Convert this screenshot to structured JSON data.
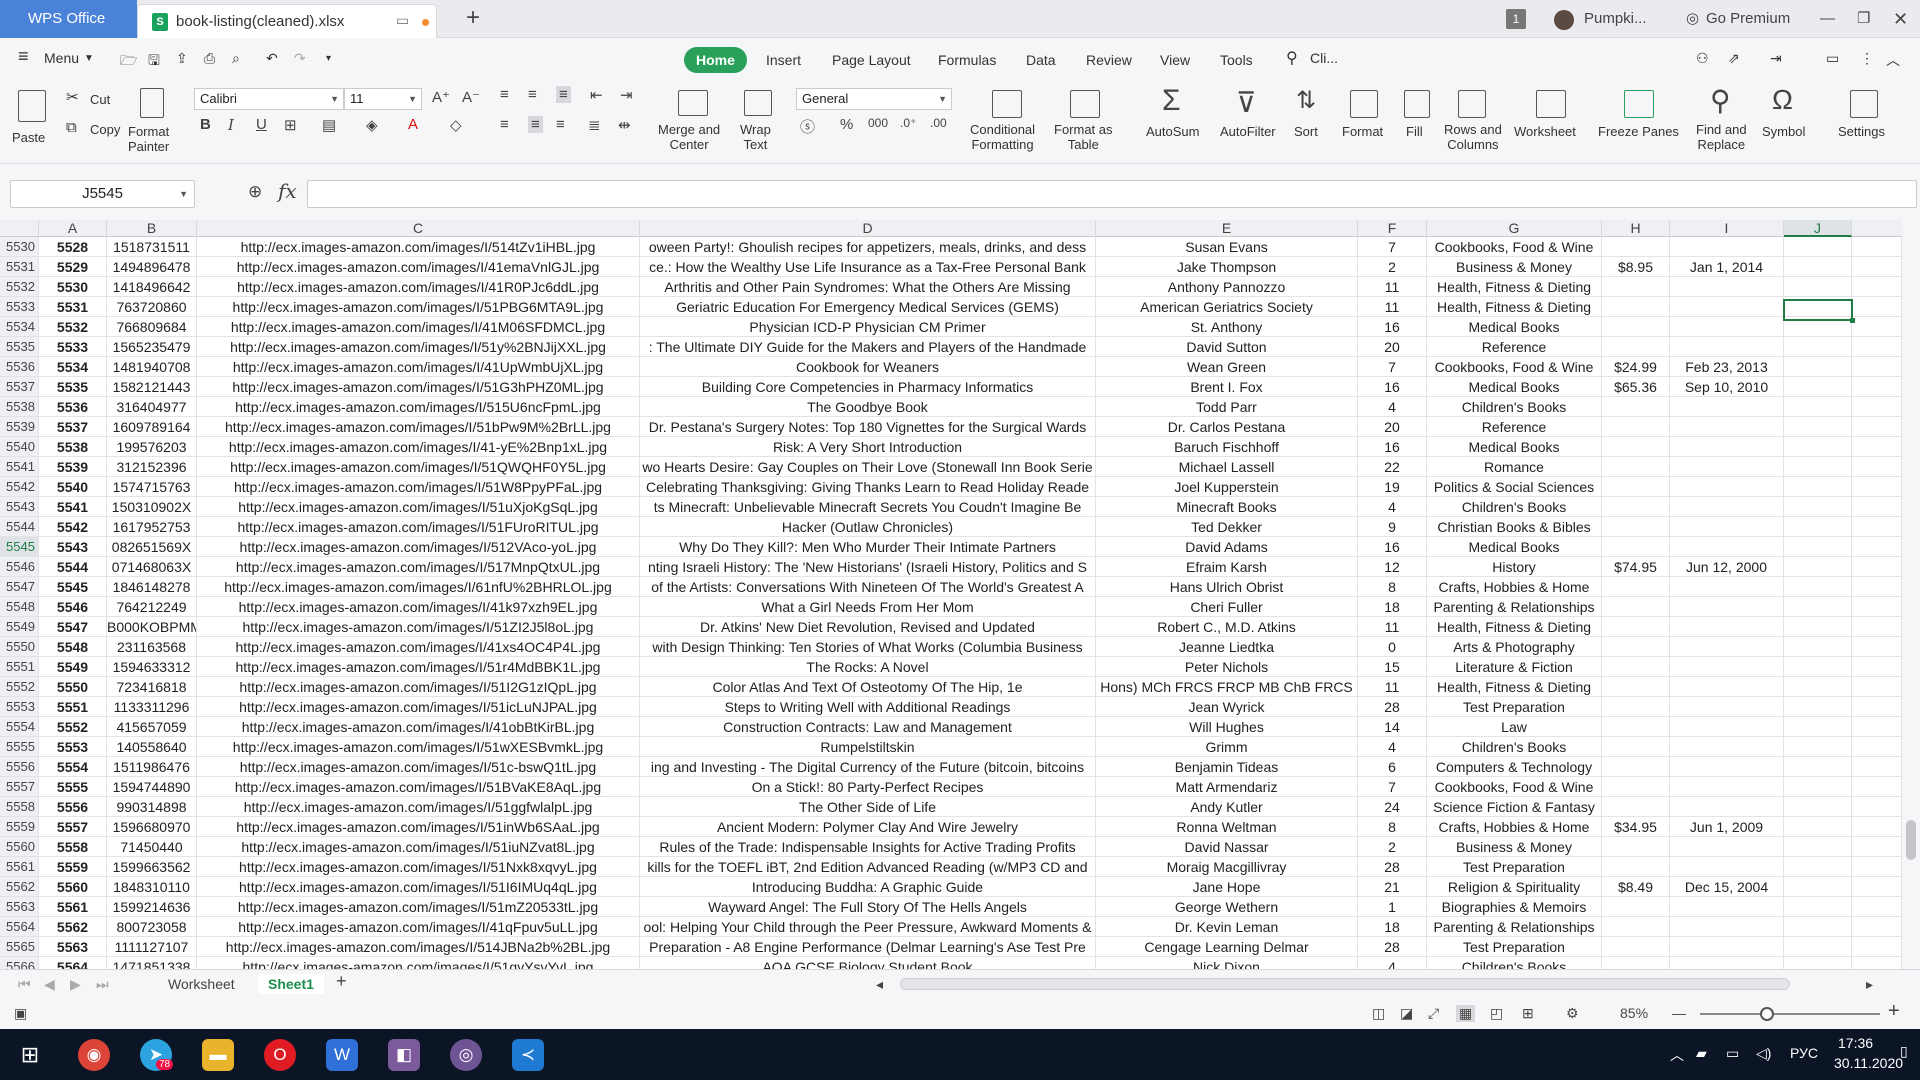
{
  "titlebar": {
    "app_name": "WPS Office",
    "doc_name": "book-listing(cleaned).xlsx",
    "window_count": "1",
    "user_name": "Pumpki...",
    "premium": "Go Premium"
  },
  "menu": {
    "menu_label": "Menu",
    "tabs": [
      "Home",
      "Insert",
      "Page Layout",
      "Formulas",
      "Data",
      "Review",
      "View",
      "Tools"
    ],
    "search": "Cli..."
  },
  "ribbon": {
    "paste": "Paste",
    "cut": "Cut",
    "copy": "Copy",
    "format_painter": "Format\nPainter",
    "font": "Calibri",
    "font_size": "11",
    "merge": "Merge and\nCenter",
    "wrap": "Wrap\nText",
    "number_format": "General",
    "cond_format": "Conditional\nFormatting",
    "format_table": "Format as\nTable",
    "autosum": "AutoSum",
    "autofilter": "AutoFilter",
    "sort": "Sort",
    "format": "Format",
    "fill": "Fill",
    "rows_cols": "Rows and\nColumns",
    "worksheet": "Worksheet",
    "freeze": "Freeze Panes",
    "find_replace": "Find and\nReplace",
    "symbol": "Symbol",
    "settings": "Settings"
  },
  "formula_bar": {
    "name_box": "J5545",
    "fx": "fx",
    "formula": ""
  },
  "columns": [
    "A",
    "B",
    "C",
    "D",
    "E",
    "F",
    "G",
    "H",
    "I",
    "J"
  ],
  "rows": [
    {
      "r": "5530",
      "a": "5528",
      "b": "1518731511",
      "c": "http://ecx.images-amazon.com/images/I/514tZv1iHBL.jpg",
      "d": "oween Party!: Ghoulish recipes for appetizers, meals, drinks, and dess",
      "e": "Susan Evans",
      "f": "7",
      "g": "Cookbooks, Food & Wine",
      "h": "",
      "i": ""
    },
    {
      "r": "5531",
      "a": "5529",
      "b": "1494896478",
      "c": "http://ecx.images-amazon.com/images/I/41emaVnlGJL.jpg",
      "d": "ce.: How the Wealthy Use Life Insurance as a Tax-Free Personal Bank",
      "e": "Jake Thompson",
      "f": "2",
      "g": "Business & Money",
      "h": "$8.95",
      "i": "Jan 1, 2014"
    },
    {
      "r": "5532",
      "a": "5530",
      "b": "1418496642",
      "c": "http://ecx.images-amazon.com/images/I/41R0PJc6ddL.jpg",
      "d": "Arthritis and Other Pain Syndromes: What the Others Are Missing",
      "e": "Anthony Pannozzo",
      "f": "11",
      "g": "Health, Fitness & Dieting",
      "h": "",
      "i": ""
    },
    {
      "r": "5533",
      "a": "5531",
      "b": "763720860",
      "c": "http://ecx.images-amazon.com/images/I/51PBG6MTA9L.jpg",
      "d": "Geriatric Education For Emergency Medical Services (GEMS)",
      "e": "American Geriatrics Society",
      "f": "11",
      "g": "Health, Fitness & Dieting",
      "h": "",
      "i": ""
    },
    {
      "r": "5534",
      "a": "5532",
      "b": "766809684",
      "c": "http://ecx.images-amazon.com/images/I/41M06SFDMCL.jpg",
      "d": "Physician ICD-P Physician CM Primer",
      "e": "St. Anthony",
      "f": "16",
      "g": "Medical Books",
      "h": "",
      "i": ""
    },
    {
      "r": "5535",
      "a": "5533",
      "b": "1565235479",
      "c": "http://ecx.images-amazon.com/images/I/51y%2BNJijXXL.jpg",
      "d": ": The Ultimate DIY Guide for the Makers and Players of the Handmade",
      "e": "David Sutton",
      "f": "20",
      "g": "Reference",
      "h": "",
      "i": ""
    },
    {
      "r": "5536",
      "a": "5534",
      "b": "1481940708",
      "c": "http://ecx.images-amazon.com/images/I/41UpWmbUjXL.jpg",
      "d": "Cookbook for Weaners",
      "e": "Wean Green",
      "f": "7",
      "g": "Cookbooks, Food & Wine",
      "h": "$24.99",
      "i": "Feb 23, 2013"
    },
    {
      "r": "5537",
      "a": "5535",
      "b": "1582121443",
      "c": "http://ecx.images-amazon.com/images/I/51G3hPHZ0ML.jpg",
      "d": "Building Core Competencies in Pharmacy Informatics",
      "e": "Brent I. Fox",
      "f": "16",
      "g": "Medical Books",
      "h": "$65.36",
      "i": "Sep 10, 2010"
    },
    {
      "r": "5538",
      "a": "5536",
      "b": "316404977",
      "c": "http://ecx.images-amazon.com/images/I/515U6ncFpmL.jpg",
      "d": "The Goodbye Book",
      "e": "Todd Parr",
      "f": "4",
      "g": "Children's Books",
      "h": "",
      "i": ""
    },
    {
      "r": "5539",
      "a": "5537",
      "b": "1609789164",
      "c": "http://ecx.images-amazon.com/images/I/51bPw9M%2BrLL.jpg",
      "d": "Dr. Pestana's Surgery Notes: Top 180 Vignettes for the Surgical Wards",
      "e": "Dr. Carlos Pestana",
      "f": "20",
      "g": "Reference",
      "h": "",
      "i": ""
    },
    {
      "r": "5540",
      "a": "5538",
      "b": "199576203",
      "c": "http://ecx.images-amazon.com/images/I/41-yE%2Bnp1xL.jpg",
      "d": "Risk: A Very Short Introduction",
      "e": "Baruch Fischhoff",
      "f": "16",
      "g": "Medical Books",
      "h": "",
      "i": ""
    },
    {
      "r": "5541",
      "a": "5539",
      "b": "312152396",
      "c": "http://ecx.images-amazon.com/images/I/51QWQHF0Y5L.jpg",
      "d": "wo Hearts Desire: Gay Couples on Their Love (Stonewall Inn Book Serie",
      "e": "Michael Lassell",
      "f": "22",
      "g": "Romance",
      "h": "",
      "i": ""
    },
    {
      "r": "5542",
      "a": "5540",
      "b": "1574715763",
      "c": "http://ecx.images-amazon.com/images/I/51W8PpyPFaL.jpg",
      "d": "Celebrating Thanksgiving: Giving Thanks Learn to Read Holiday Reade",
      "e": "Joel Kupperstein",
      "f": "19",
      "g": "Politics & Social Sciences",
      "h": "",
      "i": ""
    },
    {
      "r": "5543",
      "a": "5541",
      "b": "150310902X",
      "c": "http://ecx.images-amazon.com/images/I/51uXjoKgSqL.jpg",
      "d": "ts  Minecraft: Unbelievable Minecraft Secrets You Coudn't Imagine Be",
      "e": "Minecraft Books",
      "f": "4",
      "g": "Children's Books",
      "h": "",
      "i": ""
    },
    {
      "r": "5544",
      "a": "5542",
      "b": "1617952753",
      "c": "http://ecx.images-amazon.com/images/I/51FUroRITUL.jpg",
      "d": "Hacker (Outlaw Chronicles)",
      "e": "Ted Dekker",
      "f": "9",
      "g": "Christian Books & Bibles",
      "h": "",
      "i": ""
    },
    {
      "r": "5545",
      "a": "5543",
      "b": "082651569X",
      "c": "http://ecx.images-amazon.com/images/I/512VAco-yoL.jpg",
      "d": "Why Do They Kill?: Men Who Murder Their Intimate Partners",
      "e": "David Adams",
      "f": "16",
      "g": "Medical Books",
      "h": "",
      "i": ""
    },
    {
      "r": "5546",
      "a": "5544",
      "b": "071468063X",
      "c": "http://ecx.images-amazon.com/images/I/517MnpQtxUL.jpg",
      "d": "nting Israeli History: The 'New Historians' (Israeli History, Politics and S",
      "e": "Efraim Karsh",
      "f": "12",
      "g": "History",
      "h": "$74.95",
      "i": "Jun 12, 2000"
    },
    {
      "r": "5547",
      "a": "5545",
      "b": "1846148278",
      "c": "http://ecx.images-amazon.com/images/I/61nfU%2BHRLOL.jpg",
      "d": "of the Artists: Conversations With Nineteen Of The World's Greatest A",
      "e": "Hans Ulrich Obrist",
      "f": "8",
      "g": "Crafts, Hobbies & Home",
      "h": "",
      "i": ""
    },
    {
      "r": "5548",
      "a": "5546",
      "b": "764212249",
      "c": "http://ecx.images-amazon.com/images/I/41k97xzh9EL.jpg",
      "d": "What a Girl Needs From Her Mom",
      "e": "Cheri Fuller",
      "f": "18",
      "g": "Parenting & Relationships",
      "h": "",
      "i": ""
    },
    {
      "r": "5549",
      "a": "5547",
      "b": "B000KOBPMM",
      "c": "http://ecx.images-amazon.com/images/I/51ZI2J5l8oL.jpg",
      "d": "Dr. Atkins' New Diet Revolution, Revised and Updated",
      "e": "Robert C., M.D. Atkins",
      "f": "11",
      "g": "Health, Fitness & Dieting",
      "h": "",
      "i": ""
    },
    {
      "r": "5550",
      "a": "5548",
      "b": "231163568",
      "c": "http://ecx.images-amazon.com/images/I/41xs4OC4P4L.jpg",
      "d": "with Design Thinking: Ten Stories of What Works (Columbia Business",
      "e": "Jeanne Liedtka",
      "f": "0",
      "g": "Arts & Photography",
      "h": "",
      "i": ""
    },
    {
      "r": "5551",
      "a": "5549",
      "b": "1594633312",
      "c": "http://ecx.images-amazon.com/images/I/51r4MdBBK1L.jpg",
      "d": "The Rocks: A Novel",
      "e": "Peter Nichols",
      "f": "15",
      "g": "Literature & Fiction",
      "h": "",
      "i": ""
    },
    {
      "r": "5552",
      "a": "5550",
      "b": "723416818",
      "c": "http://ecx.images-amazon.com/images/I/51I2G1zIQpL.jpg",
      "d": "Color Atlas And Text Of Osteotomy Of The Hip, 1e",
      "e": "Hons)  MCh  FRCS  FRCP  MB  ChB  FRCS",
      "f": "11",
      "g": "Health, Fitness & Dieting",
      "h": "",
      "i": ""
    },
    {
      "r": "5553",
      "a": "5551",
      "b": "1133311296",
      "c": "http://ecx.images-amazon.com/images/I/51icLuNJPAL.jpg",
      "d": "Steps to Writing Well with Additional Readings",
      "e": "Jean Wyrick",
      "f": "28",
      "g": "Test Preparation",
      "h": "",
      "i": ""
    },
    {
      "r": "5554",
      "a": "5552",
      "b": "415657059",
      "c": "http://ecx.images-amazon.com/images/I/41obBtKirBL.jpg",
      "d": "Construction Contracts: Law and Management",
      "e": "Will Hughes",
      "f": "14",
      "g": "Law",
      "h": "",
      "i": ""
    },
    {
      "r": "5555",
      "a": "5553",
      "b": "140558640",
      "c": "http://ecx.images-amazon.com/images/I/51wXESBvmkL.jpg",
      "d": "Rumpelstiltskin",
      "e": "Grimm",
      "f": "4",
      "g": "Children's Books",
      "h": "",
      "i": ""
    },
    {
      "r": "5556",
      "a": "5554",
      "b": "1511986476",
      "c": "http://ecx.images-amazon.com/images/I/51c-bswQ1tL.jpg",
      "d": "ing and Investing - The Digital Currency of the Future (bitcoin, bitcoins",
      "e": "Benjamin Tideas",
      "f": "6",
      "g": "Computers & Technology",
      "h": "",
      "i": ""
    },
    {
      "r": "5557",
      "a": "5555",
      "b": "1594744890",
      "c": "http://ecx.images-amazon.com/images/I/51BVaKE8AqL.jpg",
      "d": "On a Stick!: 80 Party-Perfect Recipes",
      "e": "Matt Armendariz",
      "f": "7",
      "g": "Cookbooks, Food & Wine",
      "h": "",
      "i": ""
    },
    {
      "r": "5558",
      "a": "5556",
      "b": "990314898",
      "c": "http://ecx.images-amazon.com/images/I/51ggfwlalpL.jpg",
      "d": "The Other Side of Life",
      "e": "Andy Kutler",
      "f": "24",
      "g": "Science Fiction & Fantasy",
      "h": "",
      "i": ""
    },
    {
      "r": "5559",
      "a": "5557",
      "b": "1596680970",
      "c": "http://ecx.images-amazon.com/images/I/51inWb6SAaL.jpg",
      "d": "Ancient Modern: Polymer Clay And Wire Jewelry",
      "e": "Ronna Weltman",
      "f": "8",
      "g": "Crafts, Hobbies & Home",
      "h": "$34.95",
      "i": "Jun 1, 2009"
    },
    {
      "r": "5560",
      "a": "5558",
      "b": "71450440",
      "c": "http://ecx.images-amazon.com/images/I/51iuNZvat8L.jpg",
      "d": "Rules of the Trade: Indispensable Insights for Active Trading Profits",
      "e": "David Nassar",
      "f": "2",
      "g": "Business & Money",
      "h": "",
      "i": ""
    },
    {
      "r": "5561",
      "a": "5559",
      "b": "1599663562",
      "c": "http://ecx.images-amazon.com/images/I/51Nxk8xqvyL.jpg",
      "d": "kills for the TOEFL iBT, 2nd Edition Advanced Reading (w/MP3 CD and",
      "e": "Moraig Macgillivray",
      "f": "28",
      "g": "Test Preparation",
      "h": "",
      "i": ""
    },
    {
      "r": "5562",
      "a": "5560",
      "b": "1848310110",
      "c": "http://ecx.images-amazon.com/images/I/51I6IMUq4qL.jpg",
      "d": "Introducing Buddha: A Graphic Guide",
      "e": "Jane Hope",
      "f": "21",
      "g": "Religion & Spirituality",
      "h": "$8.49",
      "i": "Dec 15, 2004"
    },
    {
      "r": "5563",
      "a": "5561",
      "b": "1599214636",
      "c": "http://ecx.images-amazon.com/images/I/51mZ20533tL.jpg",
      "d": "Wayward Angel: The Full Story Of The Hells Angels",
      "e": "George Wethern",
      "f": "1",
      "g": "Biographies & Memoirs",
      "h": "",
      "i": ""
    },
    {
      "r": "5564",
      "a": "5562",
      "b": "800723058",
      "c": "http://ecx.images-amazon.com/images/I/41qFpuv5uLL.jpg",
      "d": "ool: Helping Your Child through the Peer Pressure, Awkward Moments &",
      "e": "Dr. Kevin Leman",
      "f": "18",
      "g": "Parenting & Relationships",
      "h": "",
      "i": ""
    },
    {
      "r": "5565",
      "a": "5563",
      "b": "1111127107",
      "c": "http://ecx.images-amazon.com/images/I/514JBNa2b%2BL.jpg",
      "d": "Preparation - A8 Engine Performance (Delmar Learning's Ase Test Pre",
      "e": "Cengage Learning Delmar",
      "f": "28",
      "g": "Test Preparation",
      "h": "",
      "i": ""
    },
    {
      "r": "5566",
      "a": "5564",
      "b": "1471851338",
      "c": "http://ecx.images-amazon.com/images/I/51gvYsvYvL.jpg",
      "d": "AQA GCSE Biology Student Book",
      "e": "Nick Dixon",
      "f": "4",
      "g": "Children's Books",
      "h": "",
      "i": ""
    }
  ],
  "sheets": [
    "Worksheet",
    "Sheet1"
  ],
  "status": {
    "zoom": "85%"
  },
  "taskbar": {
    "time": "17:36",
    "date": "30.11.2020",
    "lang": "РУС",
    "telegram_badge": "78"
  }
}
